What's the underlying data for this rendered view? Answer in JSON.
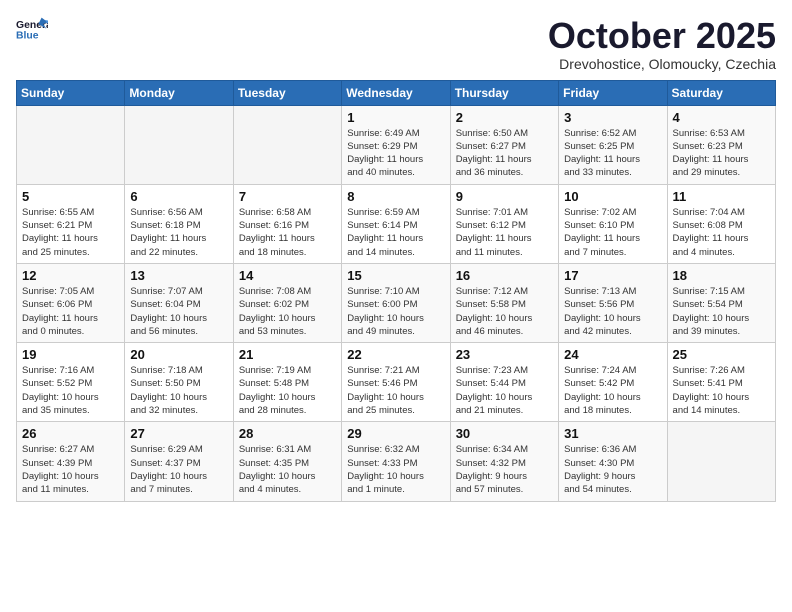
{
  "header": {
    "logo_line1": "General",
    "logo_line2": "Blue",
    "month": "October 2025",
    "location": "Drevohostice, Olomoucky, Czechia"
  },
  "days_of_week": [
    "Sunday",
    "Monday",
    "Tuesday",
    "Wednesday",
    "Thursday",
    "Friday",
    "Saturday"
  ],
  "weeks": [
    [
      {
        "day": "",
        "info": ""
      },
      {
        "day": "",
        "info": ""
      },
      {
        "day": "",
        "info": ""
      },
      {
        "day": "1",
        "info": "Sunrise: 6:49 AM\nSunset: 6:29 PM\nDaylight: 11 hours\nand 40 minutes."
      },
      {
        "day": "2",
        "info": "Sunrise: 6:50 AM\nSunset: 6:27 PM\nDaylight: 11 hours\nand 36 minutes."
      },
      {
        "day": "3",
        "info": "Sunrise: 6:52 AM\nSunset: 6:25 PM\nDaylight: 11 hours\nand 33 minutes."
      },
      {
        "day": "4",
        "info": "Sunrise: 6:53 AM\nSunset: 6:23 PM\nDaylight: 11 hours\nand 29 minutes."
      }
    ],
    [
      {
        "day": "5",
        "info": "Sunrise: 6:55 AM\nSunset: 6:21 PM\nDaylight: 11 hours\nand 25 minutes."
      },
      {
        "day": "6",
        "info": "Sunrise: 6:56 AM\nSunset: 6:18 PM\nDaylight: 11 hours\nand 22 minutes."
      },
      {
        "day": "7",
        "info": "Sunrise: 6:58 AM\nSunset: 6:16 PM\nDaylight: 11 hours\nand 18 minutes."
      },
      {
        "day": "8",
        "info": "Sunrise: 6:59 AM\nSunset: 6:14 PM\nDaylight: 11 hours\nand 14 minutes."
      },
      {
        "day": "9",
        "info": "Sunrise: 7:01 AM\nSunset: 6:12 PM\nDaylight: 11 hours\nand 11 minutes."
      },
      {
        "day": "10",
        "info": "Sunrise: 7:02 AM\nSunset: 6:10 PM\nDaylight: 11 hours\nand 7 minutes."
      },
      {
        "day": "11",
        "info": "Sunrise: 7:04 AM\nSunset: 6:08 PM\nDaylight: 11 hours\nand 4 minutes."
      }
    ],
    [
      {
        "day": "12",
        "info": "Sunrise: 7:05 AM\nSunset: 6:06 PM\nDaylight: 11 hours\nand 0 minutes."
      },
      {
        "day": "13",
        "info": "Sunrise: 7:07 AM\nSunset: 6:04 PM\nDaylight: 10 hours\nand 56 minutes."
      },
      {
        "day": "14",
        "info": "Sunrise: 7:08 AM\nSunset: 6:02 PM\nDaylight: 10 hours\nand 53 minutes."
      },
      {
        "day": "15",
        "info": "Sunrise: 7:10 AM\nSunset: 6:00 PM\nDaylight: 10 hours\nand 49 minutes."
      },
      {
        "day": "16",
        "info": "Sunrise: 7:12 AM\nSunset: 5:58 PM\nDaylight: 10 hours\nand 46 minutes."
      },
      {
        "day": "17",
        "info": "Sunrise: 7:13 AM\nSunset: 5:56 PM\nDaylight: 10 hours\nand 42 minutes."
      },
      {
        "day": "18",
        "info": "Sunrise: 7:15 AM\nSunset: 5:54 PM\nDaylight: 10 hours\nand 39 minutes."
      }
    ],
    [
      {
        "day": "19",
        "info": "Sunrise: 7:16 AM\nSunset: 5:52 PM\nDaylight: 10 hours\nand 35 minutes."
      },
      {
        "day": "20",
        "info": "Sunrise: 7:18 AM\nSunset: 5:50 PM\nDaylight: 10 hours\nand 32 minutes."
      },
      {
        "day": "21",
        "info": "Sunrise: 7:19 AM\nSunset: 5:48 PM\nDaylight: 10 hours\nand 28 minutes."
      },
      {
        "day": "22",
        "info": "Sunrise: 7:21 AM\nSunset: 5:46 PM\nDaylight: 10 hours\nand 25 minutes."
      },
      {
        "day": "23",
        "info": "Sunrise: 7:23 AM\nSunset: 5:44 PM\nDaylight: 10 hours\nand 21 minutes."
      },
      {
        "day": "24",
        "info": "Sunrise: 7:24 AM\nSunset: 5:42 PM\nDaylight: 10 hours\nand 18 minutes."
      },
      {
        "day": "25",
        "info": "Sunrise: 7:26 AM\nSunset: 5:41 PM\nDaylight: 10 hours\nand 14 minutes."
      }
    ],
    [
      {
        "day": "26",
        "info": "Sunrise: 6:27 AM\nSunset: 4:39 PM\nDaylight: 10 hours\nand 11 minutes."
      },
      {
        "day": "27",
        "info": "Sunrise: 6:29 AM\nSunset: 4:37 PM\nDaylight: 10 hours\nand 7 minutes."
      },
      {
        "day": "28",
        "info": "Sunrise: 6:31 AM\nSunset: 4:35 PM\nDaylight: 10 hours\nand 4 minutes."
      },
      {
        "day": "29",
        "info": "Sunrise: 6:32 AM\nSunset: 4:33 PM\nDaylight: 10 hours\nand 1 minute."
      },
      {
        "day": "30",
        "info": "Sunrise: 6:34 AM\nSunset: 4:32 PM\nDaylight: 9 hours\nand 57 minutes."
      },
      {
        "day": "31",
        "info": "Sunrise: 6:36 AM\nSunset: 4:30 PM\nDaylight: 9 hours\nand 54 minutes."
      },
      {
        "day": "",
        "info": ""
      }
    ]
  ]
}
